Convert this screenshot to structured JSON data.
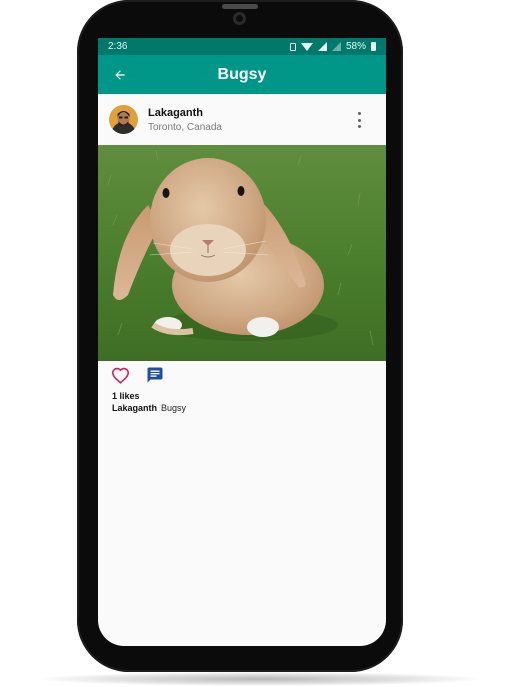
{
  "status_bar": {
    "time": "2:36",
    "battery": "58%"
  },
  "app_bar": {
    "title": "Bugsy",
    "back_icon": "arrow-left-icon"
  },
  "post": {
    "username": "Lakaganth",
    "location": "Toronto, Canada",
    "likes": "1 likes",
    "caption_user": "Lakaganth",
    "caption_text": "Bugsy",
    "image": "rabbit-photo"
  },
  "colors": {
    "status_bar": "#00796b",
    "app_bar": "#009688",
    "like_icon": "#d81b60",
    "comment_icon": "#1e4fa3",
    "screen_bg": "#fafafa"
  },
  "icons": {
    "like": "heart-outline-icon",
    "comment": "comment-icon",
    "more": "more-vertical-icon"
  }
}
